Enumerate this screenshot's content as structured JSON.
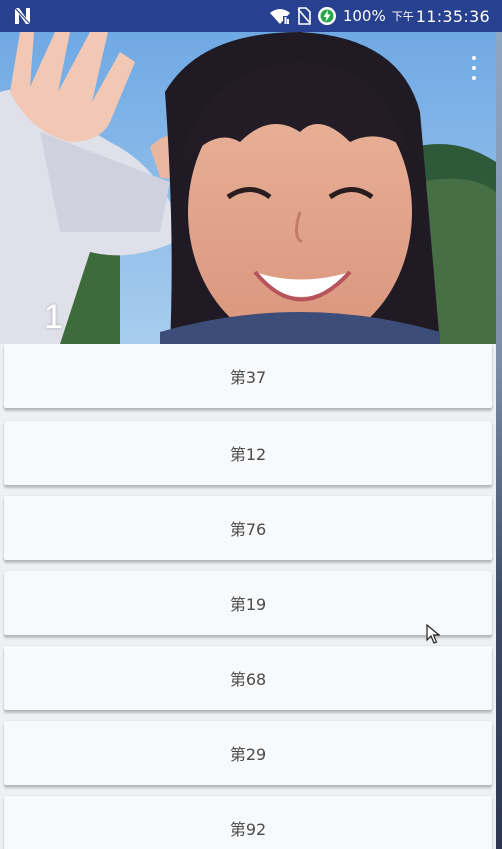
{
  "status_bar": {
    "battery_percent": "100%",
    "time_prefix": "下午",
    "time": "11:35:36",
    "left_icon": "n-notification-icon",
    "icons": [
      "wifi-icon",
      "no-sim-icon",
      "battery-charging-icon"
    ]
  },
  "header": {
    "page_number": "1",
    "menu_icon": "overflow-menu-icon"
  },
  "list": {
    "items": [
      {
        "label": "第37"
      },
      {
        "label": "第12"
      },
      {
        "label": "第76"
      },
      {
        "label": "第19"
      },
      {
        "label": "第68"
      },
      {
        "label": "第29"
      },
      {
        "label": "第92"
      }
    ]
  },
  "colors": {
    "status_bar": "#27408f",
    "card_background": "#f8f9fb",
    "list_background": "#eef0f3",
    "card_text": "#4b4b4b"
  }
}
